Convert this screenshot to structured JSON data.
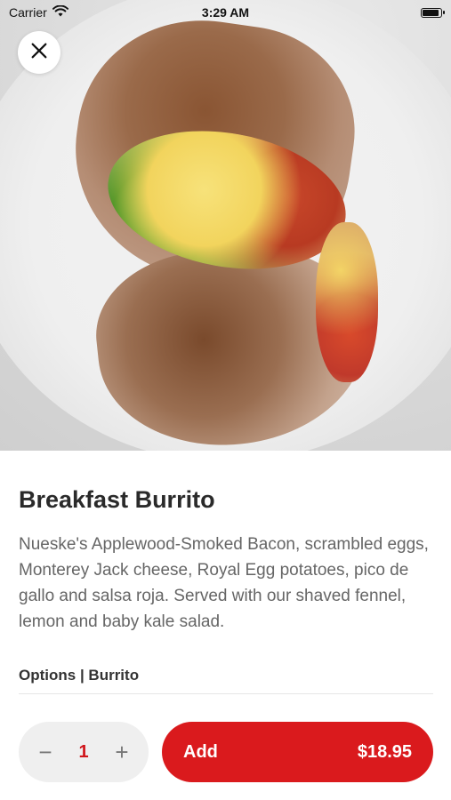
{
  "status_bar": {
    "carrier": "Carrier",
    "time": "3:29 AM"
  },
  "hero": {
    "image_alt": "Breakfast Burrito photo",
    "close_icon": "close-icon"
  },
  "item": {
    "title": "Breakfast Burrito",
    "description": "Nueske's Applewood-Smoked Bacon, scrambled eggs, Monterey Jack cheese, Royal Egg potatoes, pico de gallo and salsa roja.  Served with our shaved fennel, lemon and baby kale salad.",
    "options_label": "Options | Burrito"
  },
  "order_bar": {
    "quantity": "1",
    "decrement_symbol": "−",
    "increment_symbol": "+",
    "add_label": "Add",
    "price": "$18.95"
  },
  "colors": {
    "accent": "#da1a1d",
    "quantity_text": "#d0161b",
    "stepper_bg": "#efefef"
  }
}
